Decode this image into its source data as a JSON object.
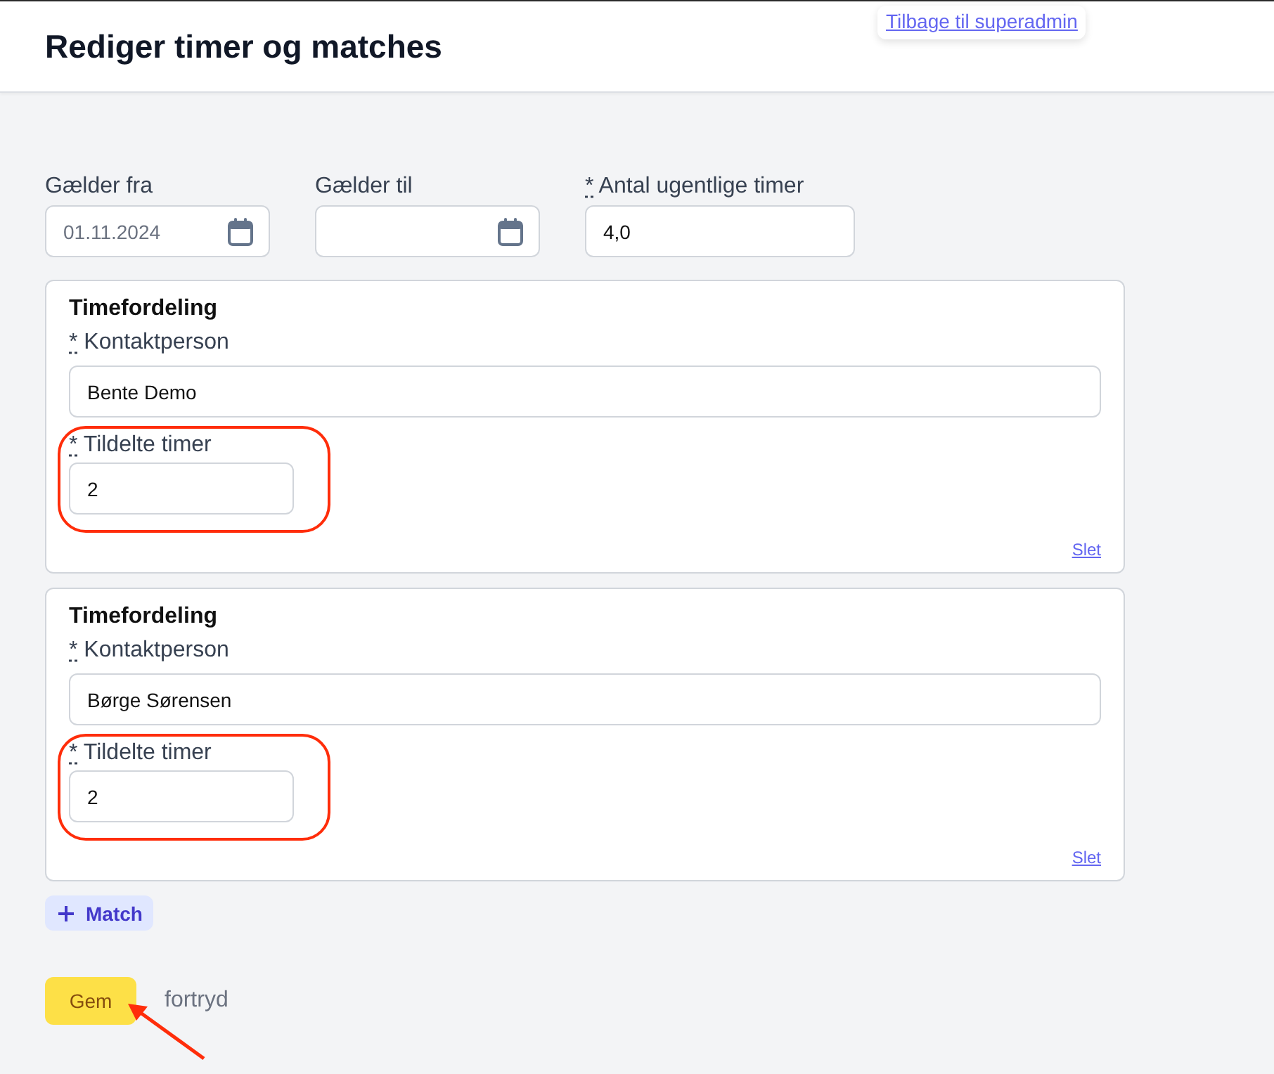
{
  "header": {
    "title": "Rediger timer og matches",
    "back_link": "Tilbage til superadmin"
  },
  "period_fields": [
    {
      "kind": "date",
      "label": "Gælder fra",
      "value": "01.11.2024"
    },
    {
      "kind": "date",
      "label": "Gælder til"
    },
    {
      "kind": "number",
      "label": "Antal ugentlige timer",
      "required_mark": "*",
      "value": "4,0"
    }
  ],
  "allocations": [
    {
      "title": "Timefordeling",
      "contact": {
        "label": "Kontaktperson",
        "required_mark": "*",
        "value": "Bente Demo"
      },
      "hours": {
        "label": "Tildelte timer",
        "required_mark": "*",
        "value": "2",
        "circled": true
      },
      "delete_link": "Slet"
    },
    {
      "title": "Timefordeling",
      "contact": {
        "label": "Kontaktperson",
        "required_mark": "*",
        "value": "Børge Sørensen"
      },
      "hours": {
        "label": "Tildelte timer",
        "required_mark": "*",
        "value": "2",
        "circled": true
      },
      "delete_link": "Slet"
    }
  ],
  "add_match_button": {
    "label": "Match"
  },
  "actions": {
    "save": {
      "label": "Gem",
      "arrow_pointed": true
    },
    "cancel": "fortryd"
  }
}
